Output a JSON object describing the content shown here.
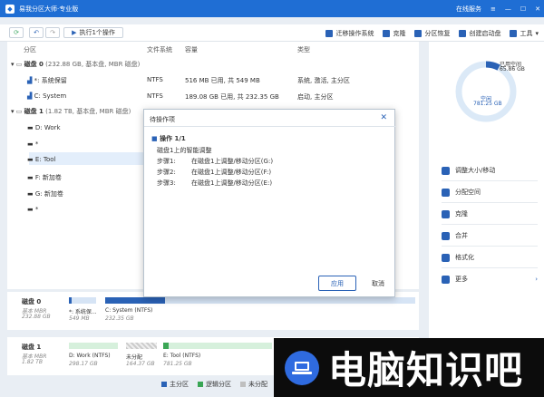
{
  "app": {
    "title": "易我分区大师·专业版",
    "titlebar_right": [
      "在线服务",
      "≡"
    ]
  },
  "toolbar": {
    "execute_label": "执行1个操作",
    "actions": [
      {
        "label": "迁移操作系统",
        "icon": "migrate-icon"
      },
      {
        "label": "克隆",
        "icon": "clone-icon"
      },
      {
        "label": "分区恢复",
        "icon": "recover-icon"
      },
      {
        "label": "创建启动盘",
        "icon": "bootdisk-icon"
      },
      {
        "label": "工具",
        "icon": "tools-icon"
      }
    ]
  },
  "table": {
    "headers": [
      "分区",
      "文件系统",
      "容量",
      "类型"
    ],
    "disk0": {
      "label": "磁盘 0",
      "info": "(232.88 GB, 基本盘, MBR 磁盘)"
    },
    "disk0_parts": [
      {
        "name": "*: 系统保留",
        "fs": "NTFS",
        "capacity": "516 MB  已用, 共 549 MB",
        "type": "系统, 激活, 主分区"
      },
      {
        "name": "C: System",
        "fs": "NTFS",
        "capacity": "189.08 GB 已用, 共 232.35 GB",
        "type": "启动, 主分区"
      }
    ],
    "disk1": {
      "label": "磁盘 1",
      "info": "(1.82 TB, 基本盘, MBR 磁盘)"
    },
    "disk1_parts": [
      "D: Work",
      "*",
      "E: Tool",
      "F: 新加卷",
      "G: 新加卷",
      "*"
    ]
  },
  "dialog": {
    "title": "待操作项",
    "operation_header": "操作 1/1",
    "line1": "磁盘1上的智能调整",
    "steps": [
      {
        "label": "步骤1:",
        "text": "在磁盘1上调整/移动分区(G:)"
      },
      {
        "label": "步骤2:",
        "text": "在磁盘1上调整/移动分区(F:)"
      },
      {
        "label": "步骤3:",
        "text": "在磁盘1上调整/移动分区(E:)"
      }
    ],
    "apply_label": "应用",
    "cancel_label": "取消"
  },
  "side": {
    "used_label": "已用空间",
    "used_value": "65.86 GB",
    "free_label": "空闲",
    "free_value": "781.25 GB",
    "used_fraction": 0.078,
    "items": [
      {
        "label": "调整大小/移动",
        "icon": "resize-icon"
      },
      {
        "label": "分配空间",
        "icon": "allocate-icon"
      },
      {
        "label": "克隆",
        "icon": "clone-icon"
      },
      {
        "label": "合并",
        "icon": "merge-icon"
      },
      {
        "label": "格式化",
        "icon": "format-icon"
      },
      {
        "label": "更多",
        "icon": "more-icon"
      }
    ]
  },
  "diskmap": {
    "disk0_label": "磁盘 0",
    "disk0_type": "基本 MBR",
    "disk0_size": "232.88 GB",
    "disk0_parts": [
      {
        "name": "*: 系统保...",
        "size": "549 MB"
      },
      {
        "name": "C: System (NTFS)",
        "size": "232.35 GB"
      }
    ],
    "disk1_label": "磁盘 1",
    "disk1_type": "基本 MBR",
    "disk1_size": "1.82 TB",
    "disk1_parts": [
      {
        "name": "D: Work (NTFS)",
        "size": "298.17 GB"
      },
      {
        "name": "未分配",
        "size": "164.37 GB"
      },
      {
        "name": "E: Tool (NTFS)",
        "size": "781.25 GB"
      }
    ]
  },
  "legend": [
    "主分区",
    "逻辑分区",
    "未分配"
  ],
  "colors": {
    "brand": "#1f6ed4",
    "primary_part": "#2a62b6",
    "logical_part": "#3aa655",
    "unallocated": "#bfbfbf"
  },
  "watermark": {
    "text": "电脑知识吧"
  }
}
